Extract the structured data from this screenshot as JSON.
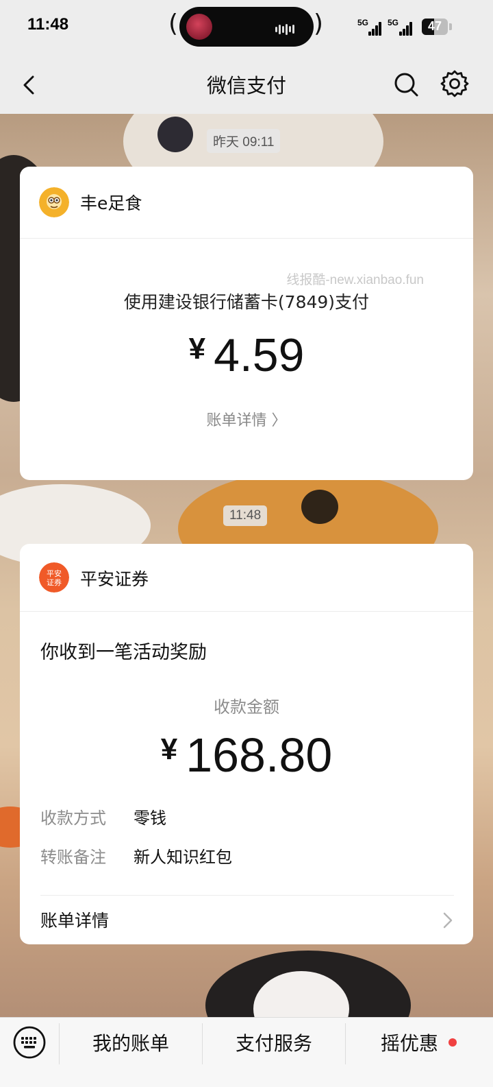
{
  "status_bar": {
    "time": "11:48",
    "signal1": "5G",
    "signal2": "5G",
    "battery": "47"
  },
  "header": {
    "title": "微信支付",
    "back_icon": "back-chevron-icon",
    "search_icon": "search-icon",
    "settings_icon": "gear-icon"
  },
  "messages": [
    {
      "timestamp": "昨天 09:11",
      "sender": "丰e足食",
      "watermark": "线报酷-new.xianbao.fun",
      "pay_method": "使用建设银行储蓄卡(7849)支付",
      "currency": "¥",
      "amount": "4.59",
      "bill_link": "账单详情 〉"
    },
    {
      "timestamp": "11:48",
      "sender": "平安证券",
      "avatar_text": "平安证券",
      "title": "你收到一笔活动奖励",
      "amount_label": "收款金额",
      "currency": "¥",
      "amount": "168.80",
      "details": [
        {
          "label": "收款方式",
          "value": "零钱"
        },
        {
          "label": "转账备注",
          "value": "新人知识红包"
        }
      ],
      "bill_link": "账单详情"
    }
  ],
  "bottom_menu": {
    "keyboard_icon": "keyboard-icon",
    "items": [
      {
        "label": "我的账单"
      },
      {
        "label": "支付服务"
      },
      {
        "label": "摇优惠",
        "has_badge": true
      }
    ]
  },
  "colors": {
    "background": "#ededed",
    "card": "#ffffff",
    "badge_red": "#f04141",
    "pingan_orange": "#f05a28",
    "fengesushi_yellow": "#f4b12a"
  }
}
